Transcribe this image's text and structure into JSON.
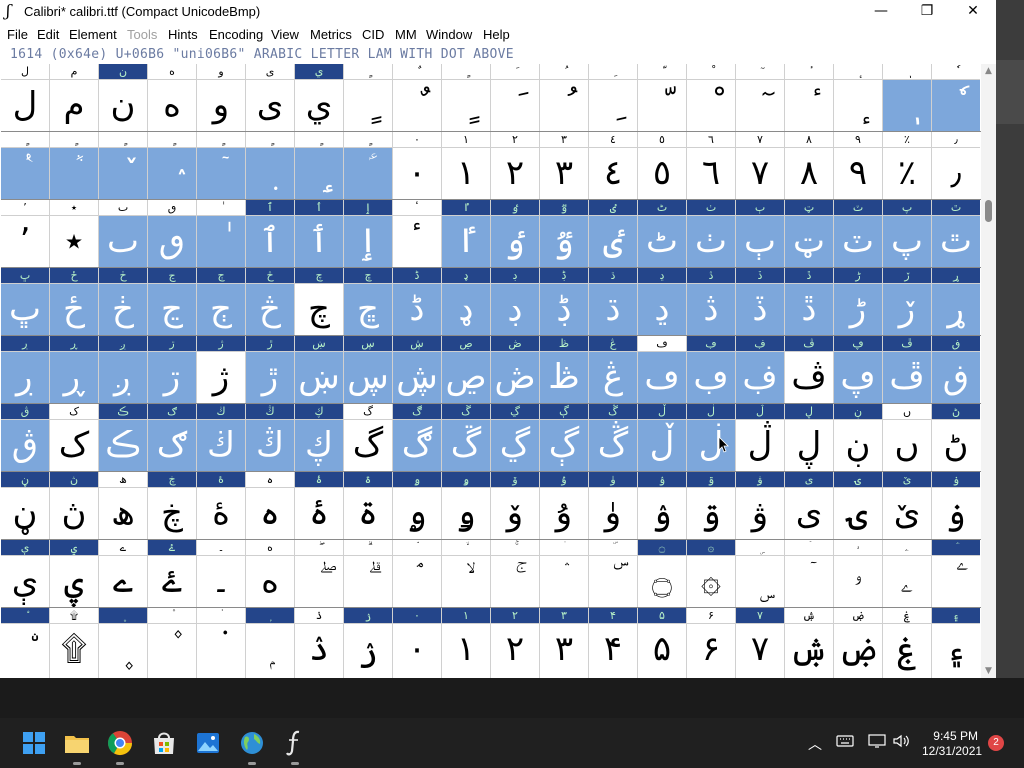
{
  "window": {
    "title": "Calibri*  calibri.ttf (Compact UnicodeBmp)",
    "controls": {
      "minimize": "—",
      "maximize": "❐",
      "close": "✕"
    }
  },
  "menu": [
    "File",
    "Edit",
    "Element",
    "Tools",
    "Hints",
    "Encoding",
    "View",
    "Metrics",
    "CID",
    "MM",
    "Window",
    "Help"
  ],
  "menu_disabled": [
    "Tools"
  ],
  "info_line": "1614 (0x64e) U+06B6 \"uni06B6\" ARABIC LETTER LAM WITH DOT ABOVE",
  "grid": {
    "rows": [
      {
        "labels": [
          "ل",
          "م",
          "ن",
          "ه",
          "و",
          "ى",
          "ي",
          "ٍ",
          "ٌ",
          "ٍ",
          "َ",
          "ُ",
          "ِ",
          "ّ",
          "ْ",
          "ٓ",
          "ٔ",
          "ٕ",
          "ٖ",
          "ٗ"
        ],
        "glyphs": [
          "ل",
          "م",
          "ن",
          "ه",
          "و",
          "ى",
          "ي",
          "ٍ",
          "ٌ",
          "ٍ",
          "َ",
          "ُ",
          "ِ",
          "ّ",
          "ْ",
          "ٓ",
          "ٔ",
          "ٕ",
          "ٖ",
          "ٗ"
        ],
        "sel": [
          0,
          0,
          0,
          0,
          0,
          0,
          0,
          0,
          0,
          0,
          0,
          0,
          0,
          0,
          0,
          0,
          0,
          0,
          1,
          1
        ],
        "hl": [
          0,
          0,
          1,
          0,
          0,
          0,
          1,
          0,
          0,
          0,
          0,
          0,
          0,
          0,
          0,
          0,
          0,
          0,
          0,
          0
        ]
      },
      {
        "labels": [
          "ٍ",
          "ٍ",
          "ٍ",
          "ٍ",
          "ٍ",
          "ٍ",
          "ٍ",
          "ٍ",
          "٠",
          "١",
          "٢",
          "٣",
          "٤",
          "٥",
          "٦",
          "٧",
          "٨",
          "٩",
          "٪",
          "٫"
        ],
        "glyphs": [
          "ٝ",
          "ٞ",
          "ٚ",
          "ٛ",
          "ٙ",
          "ٜ",
          "ٟ",
          "ؑ",
          "٠",
          "١",
          "٢",
          "٣",
          "٤",
          "٥",
          "٦",
          "٧",
          "٨",
          "٩",
          "٪",
          "٫"
        ],
        "sel": [
          1,
          1,
          1,
          1,
          1,
          1,
          1,
          1,
          0,
          0,
          0,
          0,
          0,
          0,
          0,
          0,
          0,
          0,
          0,
          0
        ],
        "hl": [
          0,
          0,
          0,
          0,
          0,
          0,
          0,
          0,
          0,
          0,
          0,
          0,
          0,
          0,
          0,
          0,
          0,
          0,
          0,
          0
        ]
      },
      {
        "labels": [
          "٬",
          "٭",
          "ٮ",
          "ٯ",
          "ٰ",
          "ٱ",
          "ٲ",
          "ٳ",
          "ٴ",
          "ٵ",
          "ٶ",
          "ٷ",
          "ٸ",
          "ٹ",
          "ٺ",
          "ٻ",
          "ټ",
          "ٽ",
          "پ",
          "ٿ"
        ],
        "glyphs": [
          "٬",
          "٭",
          "ٮ",
          "ٯ",
          "ٰ",
          "ٱ",
          "ٲ",
          "ٳ",
          "ٴ",
          "ٵ",
          "ٶ",
          "ٷ",
          "ٸ",
          "ٹ",
          "ٺ",
          "ٻ",
          "ټ",
          "ٽ",
          "پ",
          "ٿ"
        ],
        "sel": [
          0,
          0,
          1,
          1,
          1,
          1,
          1,
          1,
          0,
          1,
          1,
          1,
          1,
          1,
          1,
          1,
          1,
          1,
          1,
          1
        ],
        "hl": [
          0,
          0,
          0,
          0,
          0,
          1,
          1,
          1,
          0,
          1,
          1,
          1,
          1,
          1,
          1,
          1,
          1,
          1,
          1,
          1
        ]
      },
      {
        "labels": [
          "ڀ",
          "ځ",
          "ڂ",
          "ڃ",
          "ڄ",
          "څ",
          "چ",
          "ڇ",
          "ڈ",
          "ډ",
          "ڊ",
          "ڋ",
          "ڌ",
          "ڍ",
          "ڎ",
          "ڏ",
          "ڐ",
          "ڑ",
          "ڒ",
          "ړ"
        ],
        "glyphs": [
          "ڀ",
          "ځ",
          "ڂ",
          "ڃ",
          "ڄ",
          "څ",
          "چ",
          "ڇ",
          "ڈ",
          "ډ",
          "ڊ",
          "ڋ",
          "ڌ",
          "ڍ",
          "ڎ",
          "ڏ",
          "ڐ",
          "ڑ",
          "ڒ",
          "ړ"
        ],
        "sel": [
          1,
          1,
          1,
          1,
          1,
          1,
          0,
          1,
          1,
          1,
          1,
          1,
          1,
          1,
          1,
          1,
          1,
          1,
          1,
          1
        ],
        "hl": [
          1,
          1,
          1,
          1,
          1,
          1,
          1,
          1,
          1,
          1,
          1,
          1,
          1,
          1,
          1,
          1,
          1,
          1,
          1,
          1
        ]
      },
      {
        "labels": [
          "ڔ",
          "ڕ",
          "ږ",
          "ڗ",
          "ژ",
          "ڙ",
          "ښ",
          "ڛ",
          "ڜ",
          "ڝ",
          "ڞ",
          "ڟ",
          "ڠ",
          "ڡ",
          "ڢ",
          "ڣ",
          "ڤ",
          "ڥ",
          "ڦ",
          "ڧ"
        ],
        "glyphs": [
          "ڔ",
          "ڕ",
          "ږ",
          "ڗ",
          "ژ",
          "ڙ",
          "ښ",
          "ڛ",
          "ڜ",
          "ڝ",
          "ڞ",
          "ڟ",
          "ڠ",
          "ڡ",
          "ڢ",
          "ڣ",
          "ڤ",
          "ڥ",
          "ڦ",
          "ڧ"
        ],
        "sel": [
          1,
          1,
          1,
          1,
          0,
          1,
          1,
          1,
          1,
          1,
          1,
          1,
          1,
          1,
          1,
          1,
          0,
          1,
          1,
          1
        ],
        "hl": [
          1,
          1,
          1,
          1,
          1,
          1,
          1,
          1,
          1,
          1,
          1,
          1,
          1,
          0,
          1,
          1,
          1,
          1,
          1,
          1
        ]
      },
      {
        "labels": [
          "ڨ",
          "ک",
          "ڪ",
          "ګ",
          "ڬ",
          "ڭ",
          "ڮ",
          "گ",
          "ڰ",
          "ڱ",
          "ڲ",
          "ڳ",
          "ڴ",
          "ڵ",
          "ڶ",
          "ڷ",
          "ڸ",
          "ڹ",
          "ں",
          "ڻ"
        ],
        "glyphs": [
          "ڨ",
          "ک",
          "ڪ",
          "ګ",
          "ڬ",
          "ڭ",
          "ڮ",
          "گ",
          "ڰ",
          "ڱ",
          "ڲ",
          "ڳ",
          "ڴ",
          "ڵ",
          "ڶ",
          "ڷ",
          "ڸ",
          "ڹ",
          "ں",
          "ڻ"
        ],
        "sel": [
          1,
          0,
          1,
          1,
          1,
          1,
          1,
          0,
          1,
          1,
          1,
          1,
          1,
          1,
          1,
          0,
          0,
          0,
          0,
          0
        ],
        "hl": [
          1,
          0,
          1,
          1,
          1,
          1,
          1,
          0,
          1,
          1,
          1,
          1,
          1,
          1,
          1,
          1,
          1,
          1,
          0,
          1
        ]
      },
      {
        "labels": [
          "ڼ",
          "ڽ",
          "ھ",
          "ڿ",
          "ۀ",
          "ہ",
          "ۂ",
          "ۃ",
          "ۄ",
          "ۅ",
          "ۆ",
          "ۇ",
          "ۈ",
          "ۉ",
          "ۊ",
          "ۋ",
          "ی",
          "ۍ",
          "ێ",
          "ۏ"
        ],
        "glyphs": [
          "ڼ",
          "ڽ",
          "ھ",
          "ڿ",
          "ۀ",
          "ہ",
          "ۂ",
          "ۃ",
          "ۄ",
          "ۅ",
          "ۆ",
          "ۇ",
          "ۈ",
          "ۉ",
          "ۊ",
          "ۋ",
          "ی",
          "ۍ",
          "ێ",
          "ۏ"
        ],
        "sel": [
          0,
          0,
          0,
          0,
          0,
          0,
          0,
          0,
          0,
          0,
          0,
          0,
          0,
          0,
          0,
          0,
          0,
          0,
          0,
          0
        ],
        "hl": [
          1,
          1,
          0,
          1,
          1,
          0,
          1,
          1,
          1,
          1,
          1,
          1,
          1,
          1,
          1,
          1,
          1,
          1,
          1,
          1
        ]
      },
      {
        "labels": [
          "ې",
          "ۑ",
          "ے",
          "ۓ",
          "۔",
          "ە",
          "ۖ",
          "ۗ",
          "ۘ",
          "ۙ",
          "ۚ",
          "ۛ",
          "ۜ",
          "۝",
          "۞",
          "ۣ",
          "ۤ",
          "ۥ",
          "ۦ",
          "ۧ"
        ],
        "glyphs": [
          "ې",
          "ۑ",
          "ے",
          "ۓ",
          "۔",
          "ە",
          "ۖ",
          "ۗ",
          "ۘ",
          "ۙ",
          "ۚ",
          "ۛ",
          "ۜ",
          "۝",
          "۞",
          "ۣ",
          "ۤ",
          "ۥ",
          "ۦ",
          "ۧ"
        ],
        "sel": [
          0,
          0,
          0,
          0,
          0,
          0,
          0,
          0,
          0,
          0,
          0,
          0,
          0,
          0,
          0,
          0,
          0,
          0,
          0,
          0
        ],
        "hl": [
          1,
          1,
          0,
          1,
          0,
          0,
          0,
          0,
          0,
          0,
          0,
          0,
          0,
          1,
          1,
          0,
          0,
          0,
          0,
          1
        ]
      },
      {
        "labels": [
          "ۨ",
          "۩",
          "۪",
          "۫",
          "۬",
          "ۭ",
          "ۮ",
          "ۯ",
          "۰",
          "۱",
          "۲",
          "۳",
          "۴",
          "۵",
          "۶",
          "۷",
          "ۺ",
          "ۻ",
          "ۼ",
          "۽"
        ],
        "glyphs": [
          "ۨ",
          "۩",
          "۪",
          "۫",
          "۬",
          "ۭ",
          "ۮ",
          "ۯ",
          "۰",
          "۱",
          "۲",
          "۳",
          "۴",
          "۵",
          "۶",
          "۷",
          "ۺ",
          "ۻ",
          "ۼ",
          "۽"
        ],
        "sel": [
          0,
          0,
          0,
          0,
          0,
          0,
          0,
          0,
          0,
          0,
          0,
          0,
          0,
          0,
          0,
          0,
          0,
          0,
          0,
          0
        ],
        "hl": [
          1,
          0,
          1,
          0,
          0,
          1,
          0,
          1,
          1,
          1,
          1,
          1,
          1,
          1,
          0,
          1,
          0,
          0,
          0,
          1
        ]
      }
    ]
  },
  "taskbar": {
    "apps": [
      "start-icon",
      "explorer-icon",
      "chrome-icon",
      "store-icon",
      "photos-icon",
      "maps-icon",
      "fontforge-icon"
    ],
    "clock_time": "9:45 PM",
    "clock_date": "12/31/2021",
    "notifications": "2"
  }
}
